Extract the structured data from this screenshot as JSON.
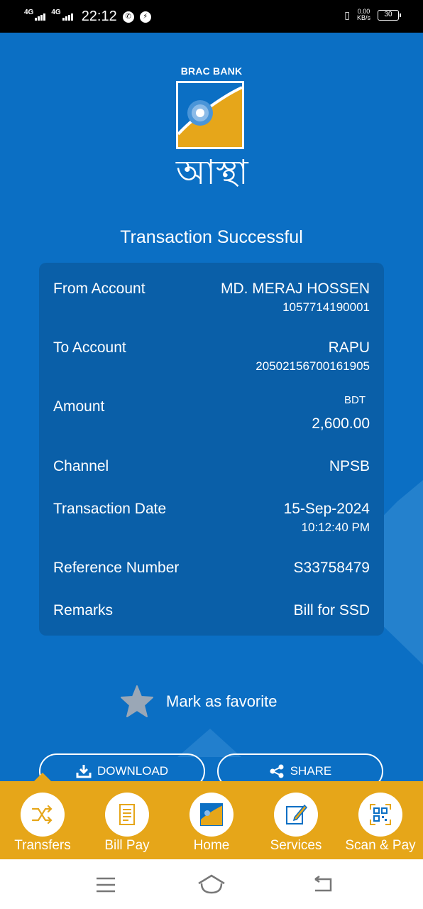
{
  "status_bar": {
    "net1": "4G",
    "net2": "4G",
    "time": "22:12",
    "speed_value": "0.00",
    "speed_unit": "KB/s",
    "battery": "30"
  },
  "logo": {
    "brand": "BRAC BANK",
    "script": "আস্থা"
  },
  "title": "Transaction Successful",
  "details": {
    "from_label": "From Account",
    "from_name": "MD. MERAJ HOSSEN",
    "from_number": "1057714190001",
    "to_label": "To Account",
    "to_name": "RAPU",
    "to_number": "20502156700161905",
    "amount_label": "Amount",
    "amount_currency": "BDT",
    "amount_value": "2,600.00",
    "channel_label": "Channel",
    "channel_value": "NPSB",
    "date_label": "Transaction Date",
    "date_value": "15-Sep-2024",
    "time_value": "10:12:40 PM",
    "ref_label": "Reference Number",
    "ref_value": "S33758479",
    "remarks_label": "Remarks",
    "remarks_value": "Bill for SSD"
  },
  "favorite_label": "Mark as favorite",
  "actions": {
    "download": "DOWNLOAD",
    "share": "SHARE"
  },
  "bottom_nav": [
    {
      "label": "Transfers",
      "icon": "transfer-icon"
    },
    {
      "label": "Bill Pay",
      "icon": "bill-icon"
    },
    {
      "label": "Home",
      "icon": "home-logo-icon"
    },
    {
      "label": "Services",
      "icon": "services-icon"
    },
    {
      "label": "Scan & Pay",
      "icon": "qr-scan-icon"
    }
  ],
  "colors": {
    "background": "#0b6fc4",
    "card": "#0a5fa8",
    "accent": "#e6a619"
  }
}
